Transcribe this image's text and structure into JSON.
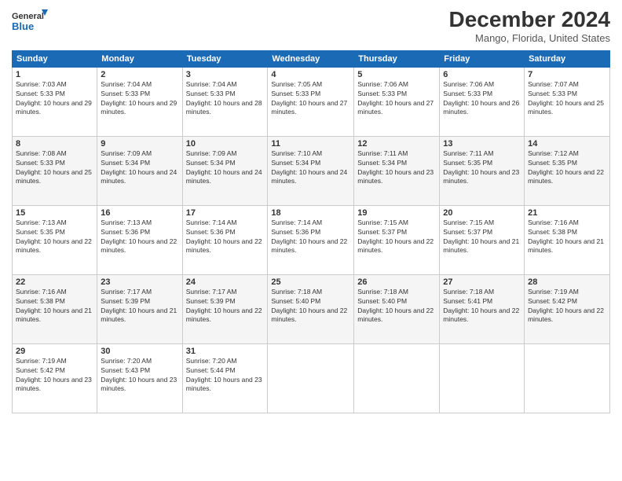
{
  "logo": {
    "line1": "General",
    "line2": "Blue"
  },
  "title": "December 2024",
  "subtitle": "Mango, Florida, United States",
  "days_header": [
    "Sunday",
    "Monday",
    "Tuesday",
    "Wednesday",
    "Thursday",
    "Friday",
    "Saturday"
  ],
  "weeks": [
    [
      {
        "day": "1",
        "sunrise": "7:03 AM",
        "sunset": "5:33 PM",
        "daylight": "10 hours and 29 minutes."
      },
      {
        "day": "2",
        "sunrise": "7:04 AM",
        "sunset": "5:33 PM",
        "daylight": "10 hours and 29 minutes."
      },
      {
        "day": "3",
        "sunrise": "7:04 AM",
        "sunset": "5:33 PM",
        "daylight": "10 hours and 28 minutes."
      },
      {
        "day": "4",
        "sunrise": "7:05 AM",
        "sunset": "5:33 PM",
        "daylight": "10 hours and 27 minutes."
      },
      {
        "day": "5",
        "sunrise": "7:06 AM",
        "sunset": "5:33 PM",
        "daylight": "10 hours and 27 minutes."
      },
      {
        "day": "6",
        "sunrise": "7:06 AM",
        "sunset": "5:33 PM",
        "daylight": "10 hours and 26 minutes."
      },
      {
        "day": "7",
        "sunrise": "7:07 AM",
        "sunset": "5:33 PM",
        "daylight": "10 hours and 25 minutes."
      }
    ],
    [
      {
        "day": "8",
        "sunrise": "7:08 AM",
        "sunset": "5:33 PM",
        "daylight": "10 hours and 25 minutes."
      },
      {
        "day": "9",
        "sunrise": "7:09 AM",
        "sunset": "5:34 PM",
        "daylight": "10 hours and 24 minutes."
      },
      {
        "day": "10",
        "sunrise": "7:09 AM",
        "sunset": "5:34 PM",
        "daylight": "10 hours and 24 minutes."
      },
      {
        "day": "11",
        "sunrise": "7:10 AM",
        "sunset": "5:34 PM",
        "daylight": "10 hours and 24 minutes."
      },
      {
        "day": "12",
        "sunrise": "7:11 AM",
        "sunset": "5:34 PM",
        "daylight": "10 hours and 23 minutes."
      },
      {
        "day": "13",
        "sunrise": "7:11 AM",
        "sunset": "5:35 PM",
        "daylight": "10 hours and 23 minutes."
      },
      {
        "day": "14",
        "sunrise": "7:12 AM",
        "sunset": "5:35 PM",
        "daylight": "10 hours and 22 minutes."
      }
    ],
    [
      {
        "day": "15",
        "sunrise": "7:13 AM",
        "sunset": "5:35 PM",
        "daylight": "10 hours and 22 minutes."
      },
      {
        "day": "16",
        "sunrise": "7:13 AM",
        "sunset": "5:36 PM",
        "daylight": "10 hours and 22 minutes."
      },
      {
        "day": "17",
        "sunrise": "7:14 AM",
        "sunset": "5:36 PM",
        "daylight": "10 hours and 22 minutes."
      },
      {
        "day": "18",
        "sunrise": "7:14 AM",
        "sunset": "5:36 PM",
        "daylight": "10 hours and 22 minutes."
      },
      {
        "day": "19",
        "sunrise": "7:15 AM",
        "sunset": "5:37 PM",
        "daylight": "10 hours and 22 minutes."
      },
      {
        "day": "20",
        "sunrise": "7:15 AM",
        "sunset": "5:37 PM",
        "daylight": "10 hours and 21 minutes."
      },
      {
        "day": "21",
        "sunrise": "7:16 AM",
        "sunset": "5:38 PM",
        "daylight": "10 hours and 21 minutes."
      }
    ],
    [
      {
        "day": "22",
        "sunrise": "7:16 AM",
        "sunset": "5:38 PM",
        "daylight": "10 hours and 21 minutes."
      },
      {
        "day": "23",
        "sunrise": "7:17 AM",
        "sunset": "5:39 PM",
        "daylight": "10 hours and 21 minutes."
      },
      {
        "day": "24",
        "sunrise": "7:17 AM",
        "sunset": "5:39 PM",
        "daylight": "10 hours and 22 minutes."
      },
      {
        "day": "25",
        "sunrise": "7:18 AM",
        "sunset": "5:40 PM",
        "daylight": "10 hours and 22 minutes."
      },
      {
        "day": "26",
        "sunrise": "7:18 AM",
        "sunset": "5:40 PM",
        "daylight": "10 hours and 22 minutes."
      },
      {
        "day": "27",
        "sunrise": "7:18 AM",
        "sunset": "5:41 PM",
        "daylight": "10 hours and 22 minutes."
      },
      {
        "day": "28",
        "sunrise": "7:19 AM",
        "sunset": "5:42 PM",
        "daylight": "10 hours and 22 minutes."
      }
    ],
    [
      {
        "day": "29",
        "sunrise": "7:19 AM",
        "sunset": "5:42 PM",
        "daylight": "10 hours and 23 minutes."
      },
      {
        "day": "30",
        "sunrise": "7:20 AM",
        "sunset": "5:43 PM",
        "daylight": "10 hours and 23 minutes."
      },
      {
        "day": "31",
        "sunrise": "7:20 AM",
        "sunset": "5:44 PM",
        "daylight": "10 hours and 23 minutes."
      },
      null,
      null,
      null,
      null
    ]
  ]
}
